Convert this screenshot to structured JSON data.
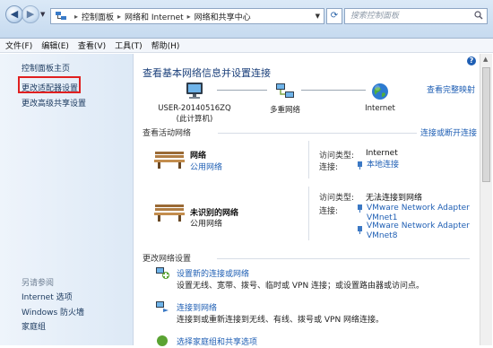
{
  "address": {
    "breadcrumb": [
      "控制面板",
      "网络和 Internet",
      "网络和共享中心"
    ],
    "search_placeholder": "搜索控制面板"
  },
  "menu": [
    "文件(F)",
    "编辑(E)",
    "查看(V)",
    "工具(T)",
    "帮助(H)"
  ],
  "sidebar": {
    "home": "控制面板主页",
    "links": [
      "更改适配器设置",
      "更改高级共享设置"
    ],
    "see_also_title": "另请参阅",
    "see_also": [
      "Internet 选项",
      "Windows 防火墙",
      "家庭组"
    ]
  },
  "main": {
    "title": "查看基本网络信息并设置连接",
    "full_map": "查看完整映射",
    "map": {
      "computer_name": "USER-20140516ZQ",
      "computer_sub": "(此计算机)",
      "middle": "多重网络",
      "right": "Internet"
    },
    "active_networks_label": "查看活动网络",
    "connect_disconnect": "连接或断开连接",
    "networks": [
      {
        "name": "网络",
        "type": "公用网络",
        "access_type_key": "访问类型:",
        "access_type_value": "Internet",
        "connections_key": "连接:",
        "connections": [
          "本地连接"
        ]
      },
      {
        "name": "未识别的网络",
        "type": "公用网络",
        "access_type_key": "访问类型:",
        "access_type_value": "无法连接到网络",
        "connections_key": "连接:",
        "connections": [
          "VMware Network Adapter VMnet1",
          "VMware Network Adapter VMnet8"
        ]
      }
    ],
    "change_settings_label": "更改网络设置",
    "tasks": [
      {
        "link": "设置新的连接或网络",
        "desc": "设置无线、宽带、拨号、临时或 VPN 连接；或设置路由器或访问点。"
      },
      {
        "link": "连接到网络",
        "desc": "连接到或重新连接到无线、有线、拨号或 VPN 网络连接。"
      },
      {
        "link": "选择家庭组和共享选项",
        "desc": ""
      }
    ]
  }
}
